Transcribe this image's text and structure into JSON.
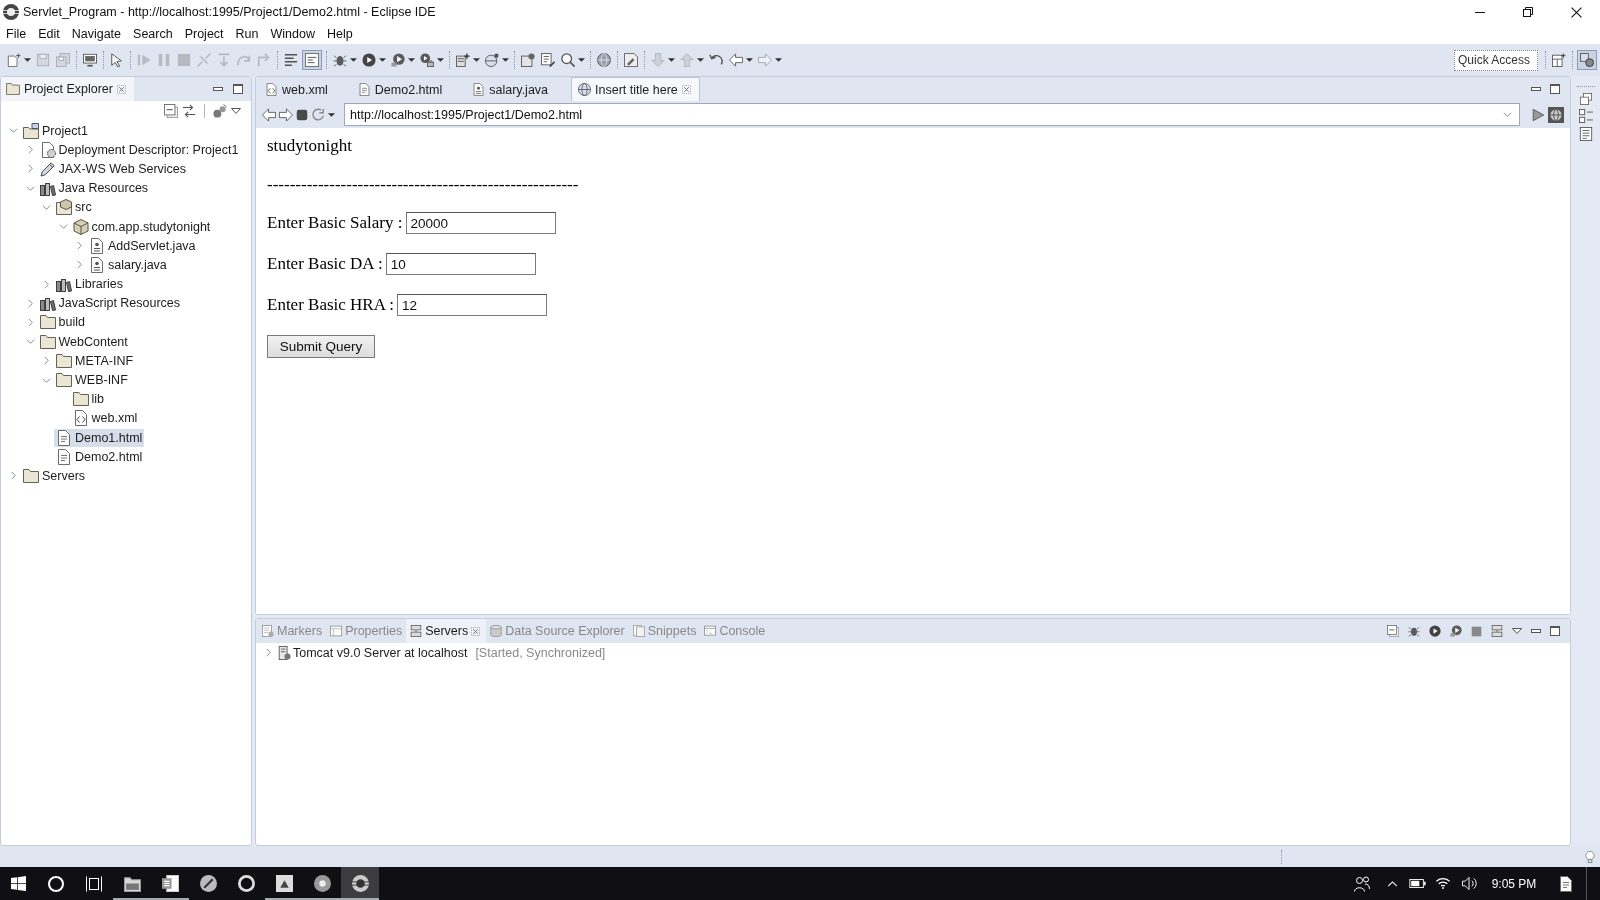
{
  "window": {
    "title": "Servlet_Program - http://localhost:1995/Project1/Demo2.html - Eclipse IDE"
  },
  "menu": [
    "File",
    "Edit",
    "Navigate",
    "Search",
    "Project",
    "Run",
    "Window",
    "Help"
  ],
  "toolbar": {
    "groups": [
      [
        {
          "kind": "new",
          "dropdown": true,
          "disabled": false,
          "pressed": false
        },
        {
          "kind": "save",
          "dropdown": false,
          "disabled": true,
          "pressed": false
        },
        {
          "kind": "saveall",
          "dropdown": false,
          "disabled": true,
          "pressed": false
        }
      ],
      [
        {
          "kind": "monitor",
          "dropdown": false,
          "disabled": false,
          "pressed": false
        }
      ],
      [
        {
          "kind": "cursor",
          "dropdown": false,
          "disabled": false,
          "pressed": false
        }
      ],
      [
        {
          "kind": "resume",
          "dropdown": false,
          "disabled": true,
          "pressed": false
        },
        {
          "kind": "suspend",
          "dropdown": false,
          "disabled": true,
          "pressed": false
        },
        {
          "kind": "terminate",
          "dropdown": false,
          "disabled": true,
          "pressed": false
        },
        {
          "kind": "disconnect",
          "dropdown": false,
          "disabled": true,
          "pressed": false
        },
        {
          "kind": "stepinto",
          "dropdown": false,
          "disabled": true,
          "pressed": false
        },
        {
          "kind": "stepover",
          "dropdown": false,
          "disabled": true,
          "pressed": false
        },
        {
          "kind": "stepreturn",
          "dropdown": false,
          "disabled": true,
          "pressed": false
        }
      ],
      [
        {
          "kind": "format",
          "dropdown": false,
          "disabled": false,
          "pressed": false
        },
        {
          "kind": "toggle",
          "dropdown": false,
          "disabled": false,
          "pressed": true
        }
      ],
      [
        {
          "kind": "debug",
          "dropdown": true,
          "disabled": false,
          "pressed": false
        },
        {
          "kind": "run",
          "dropdown": true,
          "disabled": false,
          "pressed": false
        },
        {
          "kind": "coverage",
          "dropdown": true,
          "disabled": false,
          "pressed": false
        },
        {
          "kind": "tools",
          "dropdown": true,
          "disabled": false,
          "pressed": false
        }
      ],
      [
        {
          "kind": "server",
          "dropdown": true,
          "disabled": false,
          "pressed": false
        },
        {
          "kind": "web",
          "dropdown": true,
          "disabled": false,
          "pressed": false
        }
      ],
      [
        {
          "kind": "opentype",
          "dropdown": false,
          "disabled": false,
          "pressed": false
        },
        {
          "kind": "opentask",
          "dropdown": false,
          "disabled": false,
          "pressed": false
        },
        {
          "kind": "search",
          "dropdown": true,
          "disabled": false,
          "pressed": false
        }
      ],
      [
        {
          "kind": "globe",
          "dropdown": false,
          "disabled": false,
          "pressed": false
        }
      ],
      [
        {
          "kind": "annotation",
          "dropdown": false,
          "disabled": false,
          "pressed": false
        }
      ],
      [
        {
          "kind": "nextmark",
          "dropdown": true,
          "disabled": true,
          "pressed": false
        },
        {
          "kind": "prevmark",
          "dropdown": true,
          "disabled": true,
          "pressed": false
        },
        {
          "kind": "history",
          "dropdown": false,
          "disabled": false,
          "pressed": false
        },
        {
          "kind": "back",
          "dropdown": true,
          "disabled": false,
          "pressed": false
        },
        {
          "kind": "forward",
          "dropdown": true,
          "disabled": true,
          "pressed": false
        }
      ]
    ],
    "quick_access": {
      "placeholder": "Quick Access"
    },
    "perspectives": [
      {
        "kind": "javaee",
        "selected": true
      }
    ]
  },
  "project_explorer": {
    "title": "Project Explorer",
    "tree": [
      {
        "label": "Project1",
        "kind": "project",
        "expanded": true,
        "selected": false,
        "children": [
          {
            "label": "Deployment Descriptor: Project1",
            "kind": "descriptor",
            "expanded": false,
            "selected": false
          },
          {
            "label": "JAX-WS Web Services",
            "kind": "webservices",
            "expanded": false,
            "selected": false
          },
          {
            "label": "Java Resources",
            "kind": "library",
            "expanded": true,
            "selected": false,
            "children": [
              {
                "label": "src",
                "kind": "srcfolder",
                "expanded": true,
                "selected": false,
                "children": [
                  {
                    "label": "com.app.studytonight",
                    "kind": "package",
                    "expanded": true,
                    "selected": false,
                    "children": [
                      {
                        "label": "AddServlet.java",
                        "kind": "java",
                        "expanded": false,
                        "selected": false
                      },
                      {
                        "label": "salary.java",
                        "kind": "java",
                        "expanded": false,
                        "selected": false
                      }
                    ]
                  }
                ]
              },
              {
                "label": "Libraries",
                "kind": "library",
                "expanded": false,
                "selected": false
              }
            ]
          },
          {
            "label": "JavaScript Resources",
            "kind": "library",
            "expanded": false,
            "selected": false
          },
          {
            "label": "build",
            "kind": "folder",
            "expanded": false,
            "selected": false
          },
          {
            "label": "WebContent",
            "kind": "folder",
            "expanded": true,
            "selected": false,
            "children": [
              {
                "label": "META-INF",
                "kind": "folder",
                "expanded": false,
                "selected": false
              },
              {
                "label": "WEB-INF",
                "kind": "folder",
                "expanded": true,
                "selected": false,
                "children": [
                  {
                    "label": "lib",
                    "kind": "folder",
                    "selected": false
                  },
                  {
                    "label": "web.xml",
                    "kind": "xml",
                    "selected": false
                  }
                ]
              },
              {
                "label": "Demo1.html",
                "kind": "html",
                "selected": true
              },
              {
                "label": "Demo2.html",
                "kind": "html",
                "selected": false
              }
            ]
          }
        ]
      },
      {
        "label": "Servers",
        "kind": "folder",
        "expanded": false,
        "selected": false
      }
    ]
  },
  "editor": {
    "tabs": [
      {
        "label": "web.xml",
        "kind": "xml",
        "selected": false
      },
      {
        "label": "Demo2.html",
        "kind": "html",
        "selected": false
      },
      {
        "label": "salary.java",
        "kind": "java",
        "selected": false
      },
      {
        "label": "Insert title here",
        "kind": "browser",
        "selected": true
      }
    ],
    "browser": {
      "url": "http://localhost:1995/Project1/Demo2.html",
      "page": {
        "heading": "studytonight",
        "rule": "-------------------------------------------------------",
        "fields": [
          {
            "label": "Enter Basic Salary :",
            "value": "20000"
          },
          {
            "label": "Enter Basic DA :",
            "value": "10"
          },
          {
            "label": "Enter Basic HRA :",
            "value": "12"
          }
        ],
        "submit": "Submit Query"
      }
    }
  },
  "bottom_panel": {
    "tabs": [
      {
        "label": "Markers",
        "kind": "markers",
        "selected": false
      },
      {
        "label": "Properties",
        "kind": "properties",
        "selected": false
      },
      {
        "label": "Servers",
        "kind": "servers",
        "selected": true
      },
      {
        "label": "Data Source Explorer",
        "kind": "datasource",
        "selected": false
      },
      {
        "label": "Snippets",
        "kind": "snippets",
        "selected": false
      },
      {
        "label": "Console",
        "kind": "console",
        "selected": false
      }
    ],
    "servers": [
      {
        "name": "Tomcat v9.0 Server at localhost",
        "status": "[Started, Synchronized]",
        "expanded": false
      }
    ]
  },
  "taskbar": {
    "apps": [
      {
        "kind": "files",
        "running": true,
        "selected": false
      },
      {
        "kind": "word",
        "running": true,
        "selected": false
      },
      {
        "kind": "compass",
        "running": false,
        "selected": false
      },
      {
        "kind": "ring",
        "running": false,
        "selected": false
      },
      {
        "kind": "note",
        "running": true,
        "selected": false
      },
      {
        "kind": "globe",
        "running": true,
        "selected": false
      },
      {
        "kind": "eclipse",
        "running": true,
        "selected": true
      }
    ],
    "clock": "9:05 PM"
  }
}
